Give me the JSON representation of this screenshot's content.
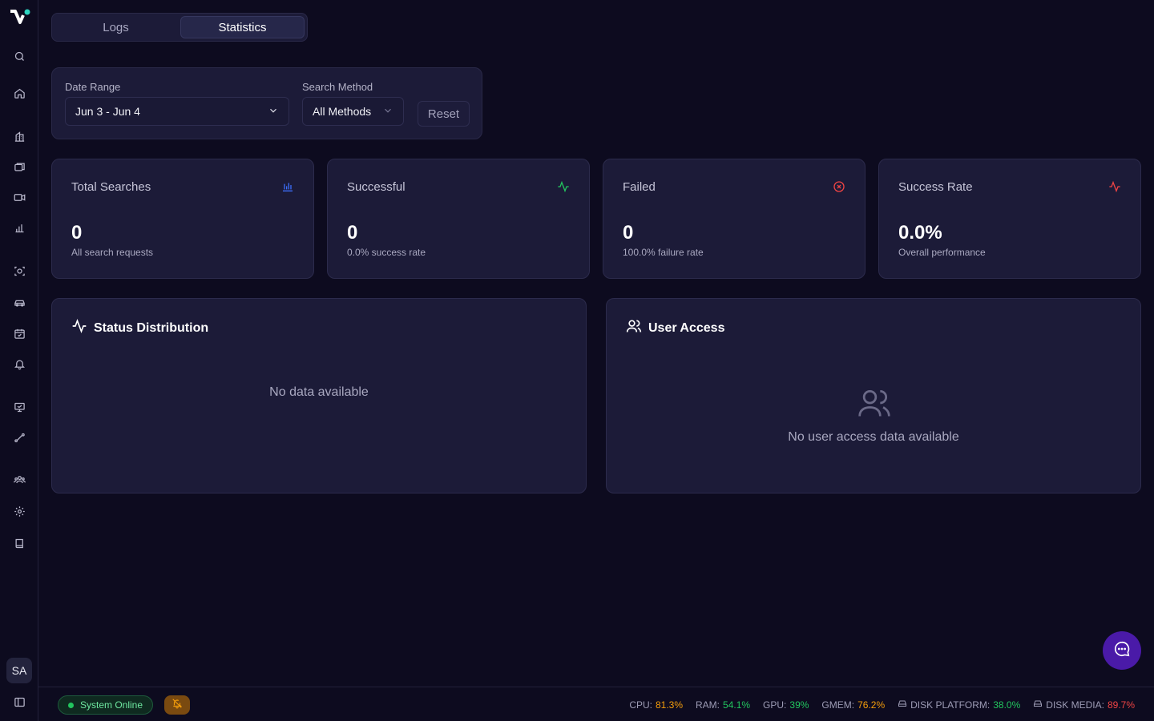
{
  "sidebar": {
    "avatar_initials": "SA",
    "items": [
      {
        "icon": "search-icon"
      },
      {
        "icon": "home-icon"
      },
      {
        "icon": "building-icon"
      },
      {
        "icon": "layers-icon"
      },
      {
        "icon": "video-icon"
      },
      {
        "icon": "bar-chart-icon"
      },
      {
        "icon": "scan-face-icon"
      },
      {
        "icon": "car-icon"
      },
      {
        "icon": "calendar-icon"
      },
      {
        "icon": "bell-icon"
      },
      {
        "icon": "presentation-icon"
      },
      {
        "icon": "route-icon"
      },
      {
        "icon": "users-group-icon"
      },
      {
        "icon": "settings-icon"
      },
      {
        "icon": "book-icon"
      },
      {
        "icon": "sidebar-toggle-icon"
      }
    ]
  },
  "tabs": [
    {
      "label": "Logs",
      "active": false
    },
    {
      "label": "Statistics",
      "active": true
    }
  ],
  "filters": {
    "date_range_label": "Date Range",
    "date_range_value": "Jun 3 - Jun 4",
    "method_label": "Search Method",
    "method_value": "All Methods",
    "reset_label": "Reset"
  },
  "stats": [
    {
      "title": "Total Searches",
      "value": "0",
      "subtitle": "All search requests",
      "icon": "bar-chart-icon",
      "color": "#3b6cf6"
    },
    {
      "title": "Successful",
      "value": "0",
      "subtitle": "0.0% success rate",
      "icon": "activity-icon",
      "color": "#22c55e"
    },
    {
      "title": "Failed",
      "value": "0",
      "subtitle": "100.0% failure rate",
      "icon": "x-circle-icon",
      "color": "#ef4444"
    },
    {
      "title": "Success Rate",
      "value": "0.0%",
      "subtitle": "Overall performance",
      "icon": "activity-icon",
      "color": "#ef4444"
    }
  ],
  "panels": {
    "status": {
      "title": "Status Distribution",
      "empty_text": "No data available"
    },
    "users": {
      "title": "User Access",
      "empty_text": "No user access data available"
    }
  },
  "footer": {
    "status_text": "System Online",
    "metrics": [
      {
        "label": "CPU:",
        "value": "81.3%",
        "color": "#f59e0b"
      },
      {
        "label": "RAM:",
        "value": "54.1%",
        "color": "#22c55e"
      },
      {
        "label": "GPU:",
        "value": "39%",
        "color": "#22c55e"
      },
      {
        "label": "GMEM:",
        "value": "76.2%",
        "color": "#f59e0b"
      },
      {
        "label": "DISK PLATFORM:",
        "value": "38.0%",
        "color": "#22c55e",
        "icon": "hard-drive-icon"
      },
      {
        "label": "DISK MEDIA:",
        "value": "89.7%",
        "color": "#ef4444",
        "icon": "hard-drive-icon"
      }
    ]
  }
}
